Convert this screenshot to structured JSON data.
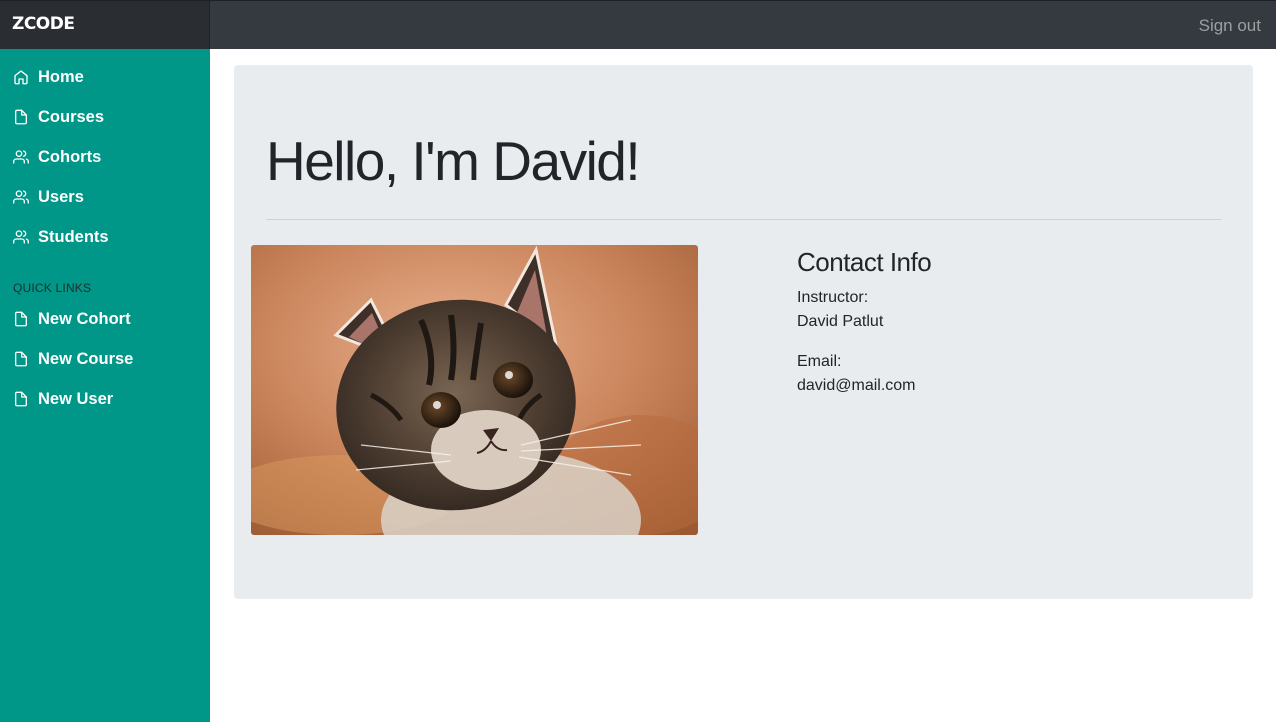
{
  "topbar": {
    "brand": "ZCODE",
    "sign_out": "Sign out"
  },
  "sidebar": {
    "items": [
      {
        "label": "Home",
        "icon": "home-icon"
      },
      {
        "label": "Courses",
        "icon": "file-icon"
      },
      {
        "label": "Cohorts",
        "icon": "users-icon"
      },
      {
        "label": "Users",
        "icon": "users-icon"
      },
      {
        "label": "Students",
        "icon": "users-icon"
      }
    ],
    "quick_links_label": "QUICK LINKS",
    "quick_links": [
      {
        "label": "New Cohort",
        "icon": "file-icon"
      },
      {
        "label": "New Course",
        "icon": "file-icon"
      },
      {
        "label": "New User",
        "icon": "file-icon"
      }
    ]
  },
  "main": {
    "greeting": "Hello, I'm David!",
    "contact": {
      "title": "Contact Info",
      "instructor_label": "Instructor:",
      "instructor_name": "David Patlut",
      "email_label": "Email:",
      "email": "david@mail.com"
    }
  },
  "colors": {
    "sidebar": "#009688",
    "topbar": "#343a40",
    "jumbotron": "#e9ecef"
  }
}
